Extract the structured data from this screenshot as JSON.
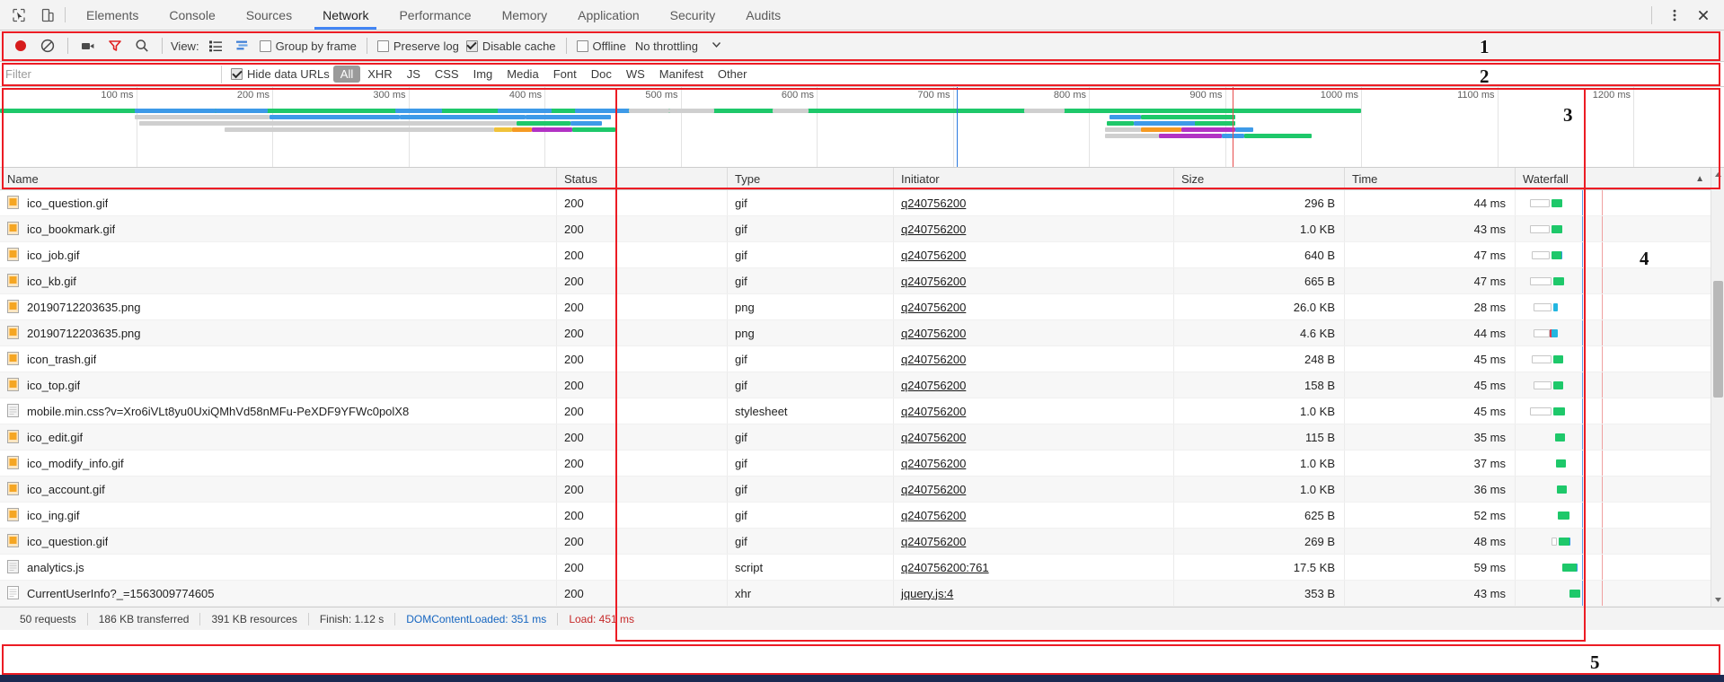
{
  "window": {
    "devtools_tabs": [
      "Elements",
      "Console",
      "Sources",
      "Network",
      "Performance",
      "Memory",
      "Application",
      "Security",
      "Audits"
    ],
    "active_tab": "Network",
    "inspect_icon": "inspect-element-icon",
    "device_icon": "device-toolbar-icon",
    "menu_icon": "more-options-icon",
    "close_icon": "close-icon"
  },
  "toolbar": {
    "record_label": "record-button",
    "clear_label": "clear-button",
    "camera_label": "capture-screenshots-button",
    "filter_label": "filter-button",
    "search_label": "search-button",
    "view_label": "View:",
    "view_list_icon": "list-view-icon",
    "view_waterfall_icon": "waterfall-view-icon",
    "group_by_frame": {
      "label": "Group by frame",
      "checked": false
    },
    "preserve_log": {
      "label": "Preserve log",
      "checked": false
    },
    "disable_cache": {
      "label": "Disable cache",
      "checked": true
    },
    "offline": {
      "label": "Offline",
      "checked": false
    },
    "throttling": {
      "value": "No throttling",
      "caret": "▼"
    }
  },
  "filterbar": {
    "placeholder": "Filter",
    "value": "",
    "hide_data_urls": {
      "label": "Hide data URLs",
      "checked": true
    },
    "types": [
      "All",
      "XHR",
      "JS",
      "CSS",
      "Img",
      "Media",
      "Font",
      "Doc",
      "WS",
      "Manifest",
      "Other"
    ],
    "selected_type": "All"
  },
  "overview": {
    "ticks": [
      "100 ms",
      "200 ms",
      "300 ms",
      "400 ms",
      "500 ms",
      "600 ms",
      "700 ms",
      "800 ms",
      "900 ms",
      "1000 ms",
      "1100 ms",
      "1200 ms"
    ],
    "dom_content_loaded_color": "#2c7ae0",
    "load_color": "#e84c4c"
  },
  "table": {
    "columns": [
      "Name",
      "Status",
      "Type",
      "Initiator",
      "Size",
      "Time",
      "Waterfall"
    ],
    "sort_indicator": "▲",
    "rows": [
      {
        "name": "ico_question.gif",
        "icon": "image-file-icon",
        "status": "200",
        "type": "gif",
        "initiator": "q240756200",
        "size": "296 B",
        "time": "44 ms"
      },
      {
        "name": "ico_bookmark.gif",
        "icon": "image-file-icon",
        "status": "200",
        "type": "gif",
        "initiator": "q240756200",
        "size": "1.0 KB",
        "time": "43 ms"
      },
      {
        "name": "ico_job.gif",
        "icon": "image-file-icon",
        "status": "200",
        "type": "gif",
        "initiator": "q240756200",
        "size": "640 B",
        "time": "47 ms"
      },
      {
        "name": "ico_kb.gif",
        "icon": "image-file-icon",
        "status": "200",
        "type": "gif",
        "initiator": "q240756200",
        "size": "665 B",
        "time": "47 ms"
      },
      {
        "name": "20190712203635.png",
        "icon": "image-file-icon",
        "status": "200",
        "type": "png",
        "initiator": "q240756200",
        "size": "26.0 KB",
        "time": "28 ms"
      },
      {
        "name": "20190712203635.png",
        "icon": "image-file-icon",
        "status": "200",
        "type": "png",
        "initiator": "q240756200",
        "size": "4.6 KB",
        "time": "44 ms"
      },
      {
        "name": "icon_trash.gif",
        "icon": "image-file-icon",
        "status": "200",
        "type": "gif",
        "initiator": "q240756200",
        "size": "248 B",
        "time": "45 ms"
      },
      {
        "name": "ico_top.gif",
        "icon": "image-file-icon",
        "status": "200",
        "type": "gif",
        "initiator": "q240756200",
        "size": "158 B",
        "time": "45 ms"
      },
      {
        "name": "mobile.min.css?v=Xro6iVLt8yu0UxiQMhVd58nMFu-PeXDF9YFWc0polX8",
        "icon": "stylesheet-file-icon",
        "status": "200",
        "type": "stylesheet",
        "initiator": "q240756200",
        "size": "1.0 KB",
        "time": "45 ms"
      },
      {
        "name": "ico_edit.gif",
        "icon": "image-file-icon",
        "status": "200",
        "type": "gif",
        "initiator": "q240756200",
        "size": "115 B",
        "time": "35 ms"
      },
      {
        "name": "ico_modify_info.gif",
        "icon": "image-file-icon",
        "status": "200",
        "type": "gif",
        "initiator": "q240756200",
        "size": "1.0 KB",
        "time": "37 ms"
      },
      {
        "name": "ico_account.gif",
        "icon": "image-file-icon",
        "status": "200",
        "type": "gif",
        "initiator": "q240756200",
        "size": "1.0 KB",
        "time": "36 ms"
      },
      {
        "name": "ico_ing.gif",
        "icon": "image-file-icon",
        "status": "200",
        "type": "gif",
        "initiator": "q240756200",
        "size": "625 B",
        "time": "52 ms"
      },
      {
        "name": "ico_question.gif",
        "icon": "image-file-icon",
        "status": "200",
        "type": "gif",
        "initiator": "q240756200",
        "size": "269 B",
        "time": "48 ms"
      },
      {
        "name": "analytics.js",
        "icon": "script-file-icon",
        "status": "200",
        "type": "script",
        "initiator": "q240756200:761",
        "size": "17.5 KB",
        "time": "59 ms"
      },
      {
        "name": "CurrentUserInfo?_=1563009774605",
        "icon": "xhr-file-icon",
        "status": "200",
        "type": "xhr",
        "initiator": "jquery.js:4",
        "size": "353 B",
        "time": "43 ms"
      }
    ]
  },
  "status": {
    "requests": "50 requests",
    "transferred": "186 KB transferred",
    "resources": "391 KB resources",
    "finish": "Finish: 1.12 s",
    "dcl": "DOMContentLoaded: 351 ms",
    "load": "Load: 451 ms"
  },
  "annotations": [
    {
      "number": "1"
    },
    {
      "number": "2"
    },
    {
      "number": "3"
    },
    {
      "number": "4"
    },
    {
      "number": "5"
    }
  ]
}
